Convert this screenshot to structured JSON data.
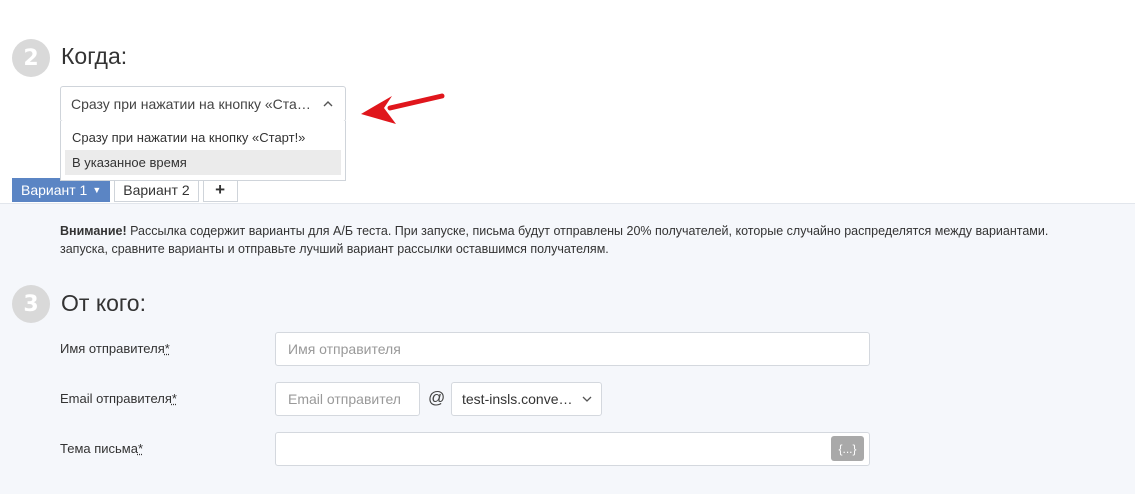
{
  "section_when": {
    "number": "2",
    "title": "Когда:"
  },
  "timing_select": {
    "selected": "Сразу при нажатии на кнопку «Старт!»",
    "options": [
      "Сразу при нажатии на кнопку «Старт!»",
      "В указанное время"
    ]
  },
  "variant_tabs": {
    "tab1": "Вариант 1",
    "tab2": "Вариант 2",
    "add": "+"
  },
  "notice": {
    "strong": "Внимание!",
    "line1": " Рассылка содержит варианты для А/Б теста. При запуске, письма будут отправлены 20% получателей, которые случайно распределятся между вариантами.",
    "line2": "запуска, сравните варианты и отправьте лучший вариант рассылки оставшимся получателям."
  },
  "section_from": {
    "number": "3",
    "title": "От кого:"
  },
  "sender_name": {
    "label": "Имя отправителя",
    "required_mark": "*",
    "placeholder": "Имя отправителя"
  },
  "sender_email": {
    "label": "Email отправителя",
    "required_mark": "*",
    "placeholder": "Email отправител",
    "at": "@",
    "domain": "test-insls.convead.io"
  },
  "subject": {
    "label": "Тема письма",
    "required_mark": "*",
    "value": "",
    "variables_button": "{...}"
  },
  "colors": {
    "accent": "#5b85c4",
    "arrow": "#e0161c"
  }
}
